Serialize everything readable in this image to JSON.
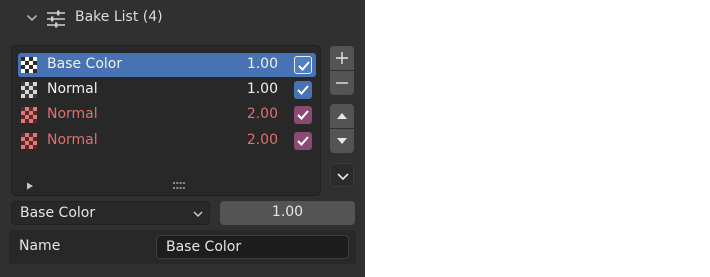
{
  "header": {
    "title": "Bake List (4)"
  },
  "bake_list": {
    "items": [
      {
        "name": "Base Color",
        "value": "1.00",
        "checked": true,
        "active": true,
        "state": "normal"
      },
      {
        "name": "Normal",
        "value": "1.00",
        "checked": true,
        "active": false,
        "state": "normal"
      },
      {
        "name": "Normal",
        "value": "2.00",
        "checked": true,
        "active": false,
        "state": "warning"
      },
      {
        "name": "Normal",
        "value": "2.00",
        "checked": true,
        "active": false,
        "state": "warning"
      }
    ]
  },
  "buttons": {
    "add": "add-icon",
    "remove": "remove-icon",
    "move_up": "triangle-up-icon",
    "move_down": "triangle-down-icon",
    "menu": "chevron-down-icon"
  },
  "properties": {
    "type_dropdown": "Base Color",
    "value_field": "1.00",
    "name_label": "Name",
    "name_value": "Base Color"
  },
  "colors": {
    "panel_bg": "#303030",
    "active_row": "#4772b3",
    "warning_text": "#e0706f",
    "warning_check": "#8b4a74",
    "checkbox_blue": "#4772b3"
  }
}
